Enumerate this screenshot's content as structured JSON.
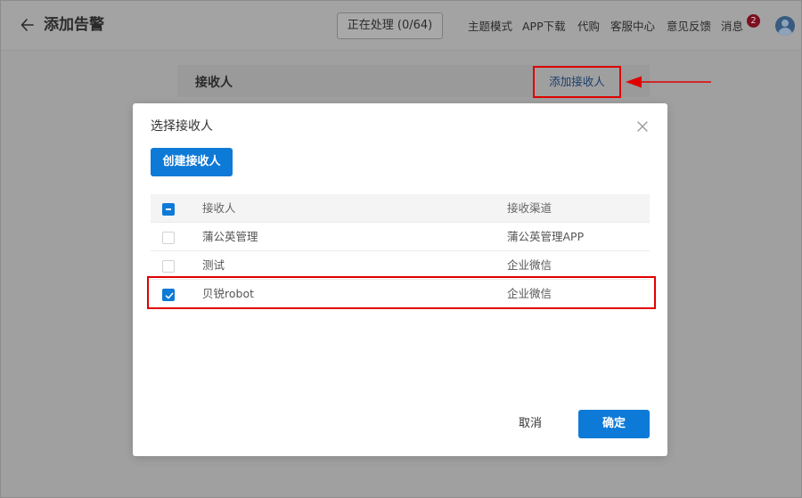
{
  "header": {
    "back_icon": "arrow-left-icon",
    "title": "添加告警",
    "processing_label": "正在处理 (0/64)",
    "nav": [
      "主题模式",
      "APP下载",
      "代购",
      "客服中心",
      "意见反馈",
      "消息"
    ],
    "message_count": "2",
    "avatar_icon": "user-avatar-icon"
  },
  "receiver_section": {
    "label": "接收人",
    "add_link": "添加接收人"
  },
  "annotation": {
    "color": "#e00000"
  },
  "modal": {
    "title": "选择接收人",
    "close_icon": "close-icon",
    "create_button": "创建接收人",
    "table": {
      "headers": {
        "name": "接收人",
        "channel": "接收渠道"
      },
      "header_checkbox_state": "indeterminate",
      "rows": [
        {
          "name": "蒲公英管理",
          "channel": "蒲公英管理APP",
          "checked": false
        },
        {
          "name": "测试",
          "channel": "企业微信",
          "checked": false
        },
        {
          "name": "贝锐robot",
          "channel": "企业微信",
          "checked": true
        }
      ]
    },
    "cancel_button": "取消",
    "ok_button": "确定"
  },
  "colors": {
    "primary": "#0e7ad7",
    "highlight": "#e00000",
    "badge": "#7a1020"
  }
}
